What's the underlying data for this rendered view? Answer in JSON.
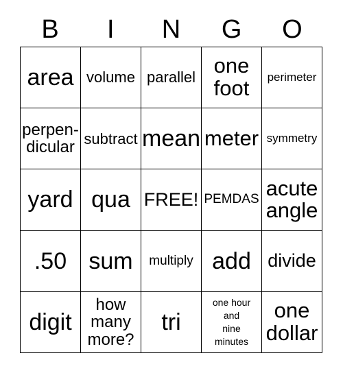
{
  "header": {
    "letters": [
      "B",
      "I",
      "N",
      "G",
      "O"
    ]
  },
  "grid": {
    "rows": 5,
    "columns": 5,
    "border_color": "#000000",
    "background_color": "#ffffff",
    "text_color": "#000000",
    "cells": [
      {
        "text": "area",
        "size": "fs-xxl"
      },
      {
        "text": "volume",
        "size": "fs-sm"
      },
      {
        "text": "parallel",
        "size": "fs-sm"
      },
      {
        "text": "one\nfoot",
        "size": "fs-xl"
      },
      {
        "text": "perimeter",
        "size": "fs-xxs"
      },
      {
        "text": "perpen-\ndicular",
        "size": "fs-md"
      },
      {
        "text": "subtract",
        "size": "fs-sm"
      },
      {
        "text": "mean",
        "size": "fs-xxl"
      },
      {
        "text": "meter",
        "size": "fs-xl"
      },
      {
        "text": "symmetry",
        "size": "fs-xxs"
      },
      {
        "text": "yard",
        "size": "fs-xxl"
      },
      {
        "text": "qua",
        "size": "fs-xxl"
      },
      {
        "text": "FREE!",
        "size": "fs-lg"
      },
      {
        "text": "PEMDAS",
        "size": "fs-xs"
      },
      {
        "text": "acute\nangle",
        "size": "fs-xl"
      },
      {
        "text": ".50",
        "size": "fs-xxl"
      },
      {
        "text": "sum",
        "size": "fs-xxl"
      },
      {
        "text": "multiply",
        "size": "fs-xs"
      },
      {
        "text": "add",
        "size": "fs-xxl"
      },
      {
        "text": "divide",
        "size": "fs-lg"
      },
      {
        "text": "digit",
        "size": "fs-xxl"
      },
      {
        "text": "how\nmany\nmore?",
        "size": "fs-md"
      },
      {
        "text": "tri",
        "size": "fs-xxl"
      },
      {
        "text": "one hour\nand\nnine\nminutes",
        "size": "fs-tiny"
      },
      {
        "text": "one\ndollar",
        "size": "fs-xl"
      }
    ]
  }
}
